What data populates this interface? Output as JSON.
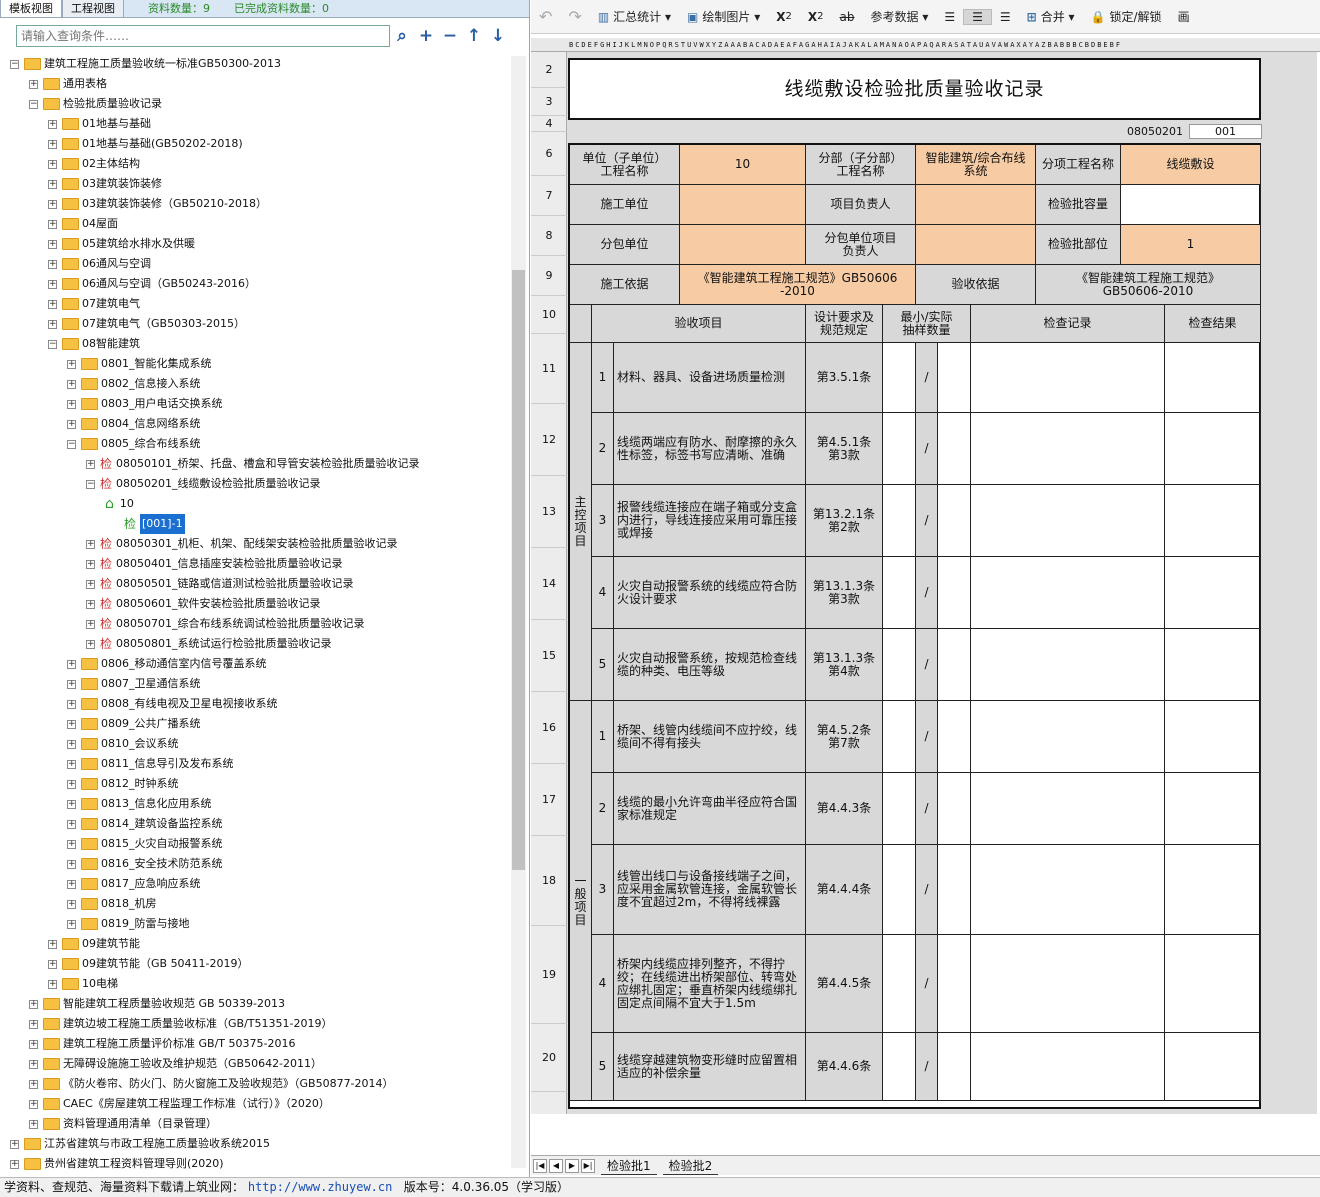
{
  "left": {
    "tabs": [
      "模板视图",
      "工程视图"
    ],
    "count_label": "资料数量：9",
    "done_label": "已完成资料数量：0",
    "search_placeholder": "请输入查询条件……"
  },
  "tree": [
    {
      "d": 0,
      "t": "建筑工程施工质量验收统一标准GB50300-2013",
      "o": 1
    },
    {
      "d": 1,
      "t": "通用表格",
      "o": 0
    },
    {
      "d": 1,
      "t": "检验批质量验收记录",
      "o": 1
    },
    {
      "d": 2,
      "t": "01地基与基础",
      "o": 0
    },
    {
      "d": 2,
      "t": "01地基与基础(GB50202-2018)",
      "o": 0
    },
    {
      "d": 2,
      "t": "02主体结构",
      "o": 0
    },
    {
      "d": 2,
      "t": "03建筑装饰装修",
      "o": 0
    },
    {
      "d": 2,
      "t": "03建筑装饰装修（GB50210-2018）",
      "o": 0
    },
    {
      "d": 2,
      "t": "04屋面",
      "o": 0
    },
    {
      "d": 2,
      "t": "05建筑给水排水及供暖",
      "o": 0
    },
    {
      "d": 2,
      "t": "06通风与空调",
      "o": 0
    },
    {
      "d": 2,
      "t": "06通风与空调（GB50243-2016）",
      "o": 0
    },
    {
      "d": 2,
      "t": "07建筑电气",
      "o": 0
    },
    {
      "d": 2,
      "t": "07建筑电气（GB50303-2015）",
      "o": 0
    },
    {
      "d": 2,
      "t": "08智能建筑",
      "o": 1
    },
    {
      "d": 3,
      "t": "0801_智能化集成系统",
      "o": 0
    },
    {
      "d": 3,
      "t": "0802_信息接入系统",
      "o": 0
    },
    {
      "d": 3,
      "t": "0803_用户电话交换系统",
      "o": 0
    },
    {
      "d": 3,
      "t": "0804_信息网络系统",
      "o": 0
    },
    {
      "d": 3,
      "t": "0805_综合布线系统",
      "o": 1
    },
    {
      "d": 4,
      "t": "08050101_桥架、托盘、槽盒和导管安装检验批质量验收记录",
      "k": "j"
    },
    {
      "d": 4,
      "t": "08050201_线缆敷设检验批质量验收记录",
      "k": "j",
      "o": 1
    },
    {
      "d": 5,
      "t": "10",
      "k": "h"
    },
    {
      "d": 6,
      "t": "[001]-1",
      "k": "s"
    },
    {
      "d": 4,
      "t": "08050301_机柜、机架、配线架安装检验批质量验收记录",
      "k": "j"
    },
    {
      "d": 4,
      "t": "08050401_信息插座安装检验批质量验收记录",
      "k": "j"
    },
    {
      "d": 4,
      "t": "08050501_链路或信道测试检验批质量验收记录",
      "k": "j"
    },
    {
      "d": 4,
      "t": "08050601_软件安装检验批质量验收记录",
      "k": "j"
    },
    {
      "d": 4,
      "t": "08050701_综合布线系统调试检验批质量验收记录",
      "k": "j"
    },
    {
      "d": 4,
      "t": "08050801_系统试运行检验批质量验收记录",
      "k": "j"
    },
    {
      "d": 3,
      "t": "0806_移动通信室内信号覆盖系统",
      "o": 0
    },
    {
      "d": 3,
      "t": "0807_卫星通信系统",
      "o": 0
    },
    {
      "d": 3,
      "t": "0808_有线电视及卫星电视接收系统",
      "o": 0
    },
    {
      "d": 3,
      "t": "0809_公共广播系统",
      "o": 0
    },
    {
      "d": 3,
      "t": "0810_会议系统",
      "o": 0
    },
    {
      "d": 3,
      "t": "0811_信息导引及发布系统",
      "o": 0
    },
    {
      "d": 3,
      "t": "0812_时钟系统",
      "o": 0
    },
    {
      "d": 3,
      "t": "0813_信息化应用系统",
      "o": 0
    },
    {
      "d": 3,
      "t": "0814_建筑设备监控系统",
      "o": 0
    },
    {
      "d": 3,
      "t": "0815_火灾自动报警系统",
      "o": 0
    },
    {
      "d": 3,
      "t": "0816_安全技术防范系统",
      "o": 0
    },
    {
      "d": 3,
      "t": "0817_应急响应系统",
      "o": 0
    },
    {
      "d": 3,
      "t": "0818_机房",
      "o": 0
    },
    {
      "d": 3,
      "t": "0819_防雷与接地",
      "o": 0
    },
    {
      "d": 2,
      "t": "09建筑节能",
      "o": 0
    },
    {
      "d": 2,
      "t": "09建筑节能（GB 50411-2019）",
      "o": 0
    },
    {
      "d": 2,
      "t": "10电梯",
      "o": 0
    },
    {
      "d": 1,
      "t": "智能建筑工程质量验收规范 GB 50339-2013",
      "o": 0
    },
    {
      "d": 1,
      "t": "建筑边坡工程施工质量验收标准（GB/T51351-2019）",
      "o": 0
    },
    {
      "d": 1,
      "t": "建筑工程施工质量评价标准 GB/T 50375-2016",
      "o": 0
    },
    {
      "d": 1,
      "t": "无障碍设施施工验收及维护规范（GB50642-2011）",
      "o": 0
    },
    {
      "d": 1,
      "t": "《防火卷帘、防火门、防火窗施工及验收规范》（GB50877-2014）",
      "o": 0
    },
    {
      "d": 1,
      "t": "CAEC《房屋建筑工程监理工作标准（试行）》（2020）",
      "o": 0
    },
    {
      "d": 1,
      "t": "资料管理通用清单（目录管理）",
      "o": 0
    },
    {
      "d": 0,
      "t": "江苏省建筑与市政工程施工质量验收系统2015",
      "o": 0
    },
    {
      "d": 0,
      "t": "贵州省建筑工程资料管理导则(2020)",
      "o": 0
    }
  ],
  "toolbar": {
    "undo": "↶",
    "redo": "↷",
    "summary": "汇总统计",
    "draw": "绘制图片",
    "sup": "X",
    "sup2": "2",
    "sub": "X",
    "sub2": "2",
    "strike": "ab",
    "ref": "参考数据",
    "merge": "合并",
    "lock": "锁定/解锁",
    "extra": "画"
  },
  "colhead": "BCDEFGHIJKLMNOPQRSTUVWXYZAAABACADAEAFAGAHAIAJAKALAMANAOAPAQARASATAUAVAWAXAYAZBABBBCBDBEBF",
  "rows": [
    "2",
    "3",
    "4",
    "6",
    "7",
    "8",
    "9",
    "10",
    "11",
    "12",
    "13",
    "14",
    "15",
    "16",
    "17",
    "18",
    "19",
    "20"
  ],
  "form": {
    "title": "线缆敷设检验批质量验收记录",
    "code1": "08050201",
    "code2": "001",
    "h": {
      "unit_l": "单位（子单位）\n工程名称",
      "unit_v": "10",
      "sub_l": "分部（子分部）\n工程名称",
      "sub_v": "智能建筑/综合布线\n系统",
      "item_l": "分项工程名称",
      "item_v": "线缆敷设",
      "constr_l": "施工单位",
      "pm_l": "项目负责人",
      "cap_l": "检验批容量",
      "subc_l": "分包单位",
      "subpm_l": "分包单位项目\n负责人",
      "part_l": "检验批部位",
      "part_v": "1",
      "basis_l": "施工依据",
      "basis_v": "《智能建筑工程施工规范》GB50606\n-2010",
      "acc_l": "验收依据",
      "acc_v": "《智能建筑工程施工规范》\nGB50606-2010"
    },
    "cols": {
      "item": "验收项目",
      "design": "设计要求及\n规范规定",
      "min": "最小/实际\n抽样数量",
      "record": "检查记录",
      "result": "检查结果"
    },
    "main_label": "主\n控\n项\n目",
    "gen_label": "一\n般\n项\n目",
    "items": [
      {
        "n": "1",
        "t": "材料、器具、设备进场质量检测",
        "s": "第3.5.1条",
        "m": "/"
      },
      {
        "n": "2",
        "t": "线缆两端应有防水、耐摩擦的永久性标签，标签书写应清晰、准确",
        "s": "第4.5.1条\n第3款",
        "m": "/"
      },
      {
        "n": "3",
        "t": "报警线缆连接应在端子箱或分支盒内进行，导线连接应采用可靠压接或焊接",
        "s": "第13.2.1条\n第2款",
        "m": "/"
      },
      {
        "n": "4",
        "t": "火灾自动报警系统的线缆应符合防火设计要求",
        "s": "第13.1.3条\n第3款",
        "m": "/"
      },
      {
        "n": "5",
        "t": "火灾自动报警系统，按规范检查线缆的种类、电压等级",
        "s": "第13.1.3条\n第4款",
        "m": "/"
      },
      {
        "n": "1",
        "t": "桥架、线管内线缆间不应拧绞，线缆间不得有接头",
        "s": "第4.5.2条\n第7款",
        "m": "/"
      },
      {
        "n": "2",
        "t": "线缆的最小允许弯曲半径应符合国家标准规定",
        "s": "第4.4.3条",
        "m": "/"
      },
      {
        "n": "3",
        "t": "线管出线口与设备接线端子之间，应采用金属软管连接，金属软管长度不宜超过2m，不得将线裸露",
        "s": "第4.4.4条",
        "m": "/"
      },
      {
        "n": "4",
        "t": "桥架内线缆应排列整齐，不得拧绞；在线缆进出桥架部位、转弯处应绑扎固定；垂直桥架内线缆绑扎固定点间隔不宜大于1.5m",
        "s": "第4.4.5条",
        "m": "/"
      },
      {
        "n": "5",
        "t": "线缆穿越建筑物变形缝时应留置相适应的补偿余量",
        "s": "第4.4.6条",
        "m": "/"
      }
    ]
  },
  "sheets": [
    "检验批1",
    "检验批2"
  ],
  "status": {
    "text": "学资料、查规范、海量资料下载请上筑业网：",
    "url": "http://www.zhuyew.cn",
    "ver": "版本号：4.0.36.05（学习版）"
  }
}
